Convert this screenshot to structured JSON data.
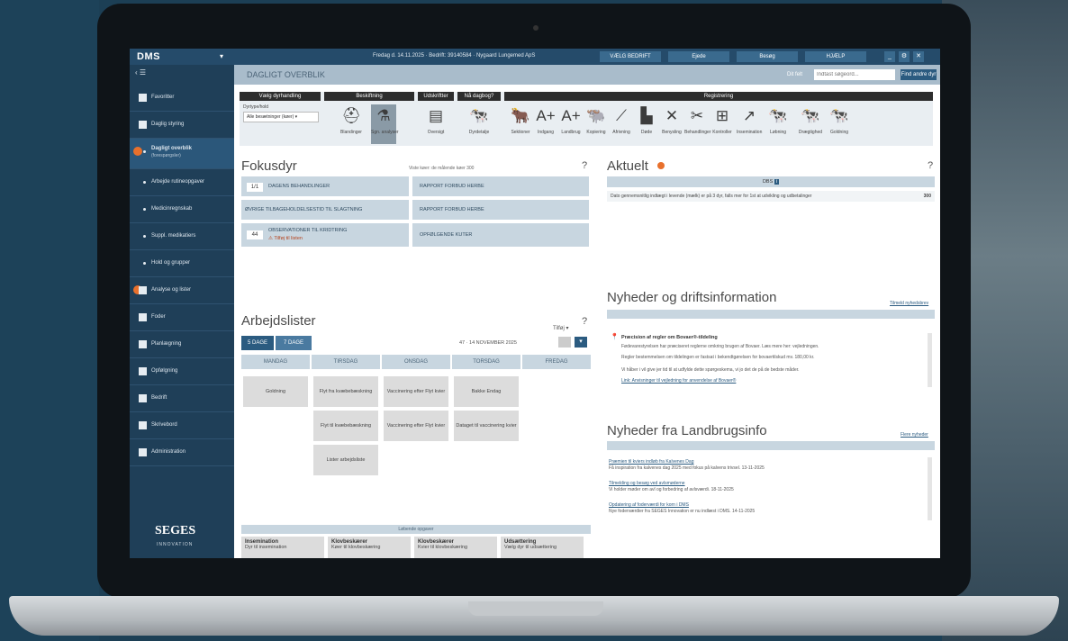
{
  "topbar": {
    "logo": "DMS",
    "farm_info": "Fredag d. 14.11.2025 · Bedrift: 39140584 · Nygaard Lungemed ApS",
    "buttons": [
      "VÆLG BEDRIFT",
      "Ejede",
      "Besøg",
      "HJÆLP"
    ]
  },
  "sidebar": {
    "items": [
      {
        "label": "Favoritter"
      },
      {
        "label": "Daglig styring"
      },
      {
        "label": "Dagligt overblik",
        "sub": "(forespørgsler)"
      },
      {
        "label": "Arbejde rutineopgaver"
      },
      {
        "label": "Medicinregnskab"
      },
      {
        "label": "Suppl. medikatiers"
      },
      {
        "label": "Hold og grupper"
      },
      {
        "label": "Analyse og lister"
      },
      {
        "label": "Foder"
      },
      {
        "label": "Planlægning"
      },
      {
        "label": "Opfølgning"
      },
      {
        "label": "Bedrift"
      },
      {
        "label": "Skrivebord"
      },
      {
        "label": "Administration"
      }
    ],
    "brand": "SEGES",
    "brand_sub": "INNOVATION"
  },
  "crumb": {
    "title": "DAGLIGT OVERBLIK",
    "search_label": "Dit felt",
    "search_placeholder": "Indtast søgeord...",
    "search_button": "Find andre dyr"
  },
  "toolbar": {
    "groups": [
      "Vælg dyrhandling",
      "Beskiftning",
      "Udskriftter",
      "Nå dagbog?",
      "Registrering"
    ],
    "select_label": "Dyrtype/hold",
    "select_value": "Alle besætninger (køer)",
    "tools": [
      {
        "icon": "⛑",
        "label": "Blandinger"
      },
      {
        "icon": "⚗",
        "label": "Sgn. analyser"
      },
      {
        "icon": "▤",
        "label": "Oversigt"
      },
      {
        "icon": "🐄",
        "label": "Dyrdetalje"
      },
      {
        "icon": "🐂",
        "label": "Sektioner"
      },
      {
        "icon": "A+",
        "label": "Indgang"
      },
      {
        "icon": "A+",
        "label": "Landbrug"
      },
      {
        "icon": "🐃",
        "label": "Kopiering"
      },
      {
        "icon": "⟋",
        "label": "Afrivning"
      },
      {
        "icon": "▙",
        "label": "Døde"
      },
      {
        "icon": "✕",
        "label": "Benysling"
      },
      {
        "icon": "✂",
        "label": "Behandlinger"
      },
      {
        "icon": "⊞",
        "label": "Kontroller"
      },
      {
        "icon": "↗",
        "label": "Insemination"
      },
      {
        "icon": "🐄",
        "label": "Løbning"
      },
      {
        "icon": "🐄",
        "label": "Drægtighed"
      },
      {
        "icon": "🐄",
        "label": "Goldning"
      }
    ]
  },
  "fokusdyr": {
    "title": "Fokusdyr",
    "note": "Viste køer: de målende køer 300",
    "tiles": [
      {
        "num": "1/1",
        "label": "DAGENS BEHANDLINGER"
      },
      {
        "num": "",
        "label": "RAPPORT FORBUD HERBE"
      },
      {
        "num": "",
        "label": "ØVRIGE TILBAGEHOLDELSESTID TIL SLAGTNING"
      },
      {
        "num": "",
        "label": "RAPPORT FORBUD HERBE"
      },
      {
        "num": "44",
        "label": "OBSERVATIONER TIL KRIDTRING",
        "sub": "Tilføj til listen"
      },
      {
        "num": "",
        "label": "OPFØLGENDE KUTER"
      }
    ]
  },
  "arbejdslister": {
    "title": "Arbejdslister",
    "tilfoej": "Tilføj",
    "tabs": [
      "5 DAGE",
      "7 DAGE"
    ],
    "week": "47 · 14 NOVEMBER 2025",
    "days": [
      "MANDAG",
      "TIRSDAG",
      "ONSDAG",
      "TORSDAG",
      "FREDAG"
    ],
    "tasks": [
      {
        "text": "Goldning"
      },
      {
        "text": "Flyt fra kvæbebæskning"
      },
      {
        "text": "Vaccinering efter Flyt kvier"
      },
      {
        "text": "Bakke Endag"
      },
      {
        "text": "Flyt til kvæbebæskning"
      },
      {
        "text": "Vaccinering efter Flyt kvier"
      },
      {
        "text": "Dataget til vaccinering kvier"
      },
      {
        "text": "Lister arbejdsliste"
      }
    ],
    "laebende": "Løbende opgaver",
    "cards": [
      {
        "title": "Insemination",
        "text": "Dyr til insemination"
      },
      {
        "title": "Klovbeskærer",
        "text": "Køer til klovbeskæring"
      },
      {
        "title": "Klovbeskærer",
        "text": "Kvier til klovbeskæring"
      },
      {
        "title": "Udsættering",
        "text": "Vælg dyr til udsættering"
      }
    ]
  },
  "aktuelt": {
    "title": "Aktuelt",
    "mini_header": "DBS",
    "text": "Dato gennemsnitlig indtægt i levende (mælk) er på 3 dyr, falls mer for 1st at udvikling og udbetalinger",
    "value": "300"
  },
  "nyheder": {
    "title": "Nyheder og driftsinformation",
    "link": "Tilmeld nyhedsbrev",
    "item_title": "Præcision af regler om Bovaer®-tildeling",
    "item_lines": [
      "Fødevarestyrelsen har præciseret reglerne omkring brugen af Bovaer. Læs mere her: vejledningen.",
      "Regler bestemmelsen om tildelingen er fastsat i bekendtgørelsen for bovaertilskud mv. 180,00 kr.",
      "Vi håber i vil give jer tid til at udfylde dette spørgeskema, vi jo det de på de bedste måder.",
      "Link: Anvisninger til vejledning for anvendelse af Bovaer®"
    ]
  },
  "landbrugsinfo": {
    "title": "Nyheder fra Landbrugsinfo",
    "link": "Flere nyheder",
    "items": [
      {
        "title": "Præmien til kviers indløb fra Kalvenes Dag",
        "text": "Få inspiration fra kalvenes dag 2025 med fokus på kalvens trivsel. 13-11-2025"
      },
      {
        "title": "Tilmelding og besøg ved avlsmøderne",
        "text": "Vi holder møder om avl og forbedring af avlsværdi. 18-11-2025"
      },
      {
        "title": "Opdatering af foderværdi for korn i DMS",
        "text": "Nye foderværdier fra SEGES Innovation er nu indlæst i DMS. 14-11-2025"
      }
    ]
  }
}
